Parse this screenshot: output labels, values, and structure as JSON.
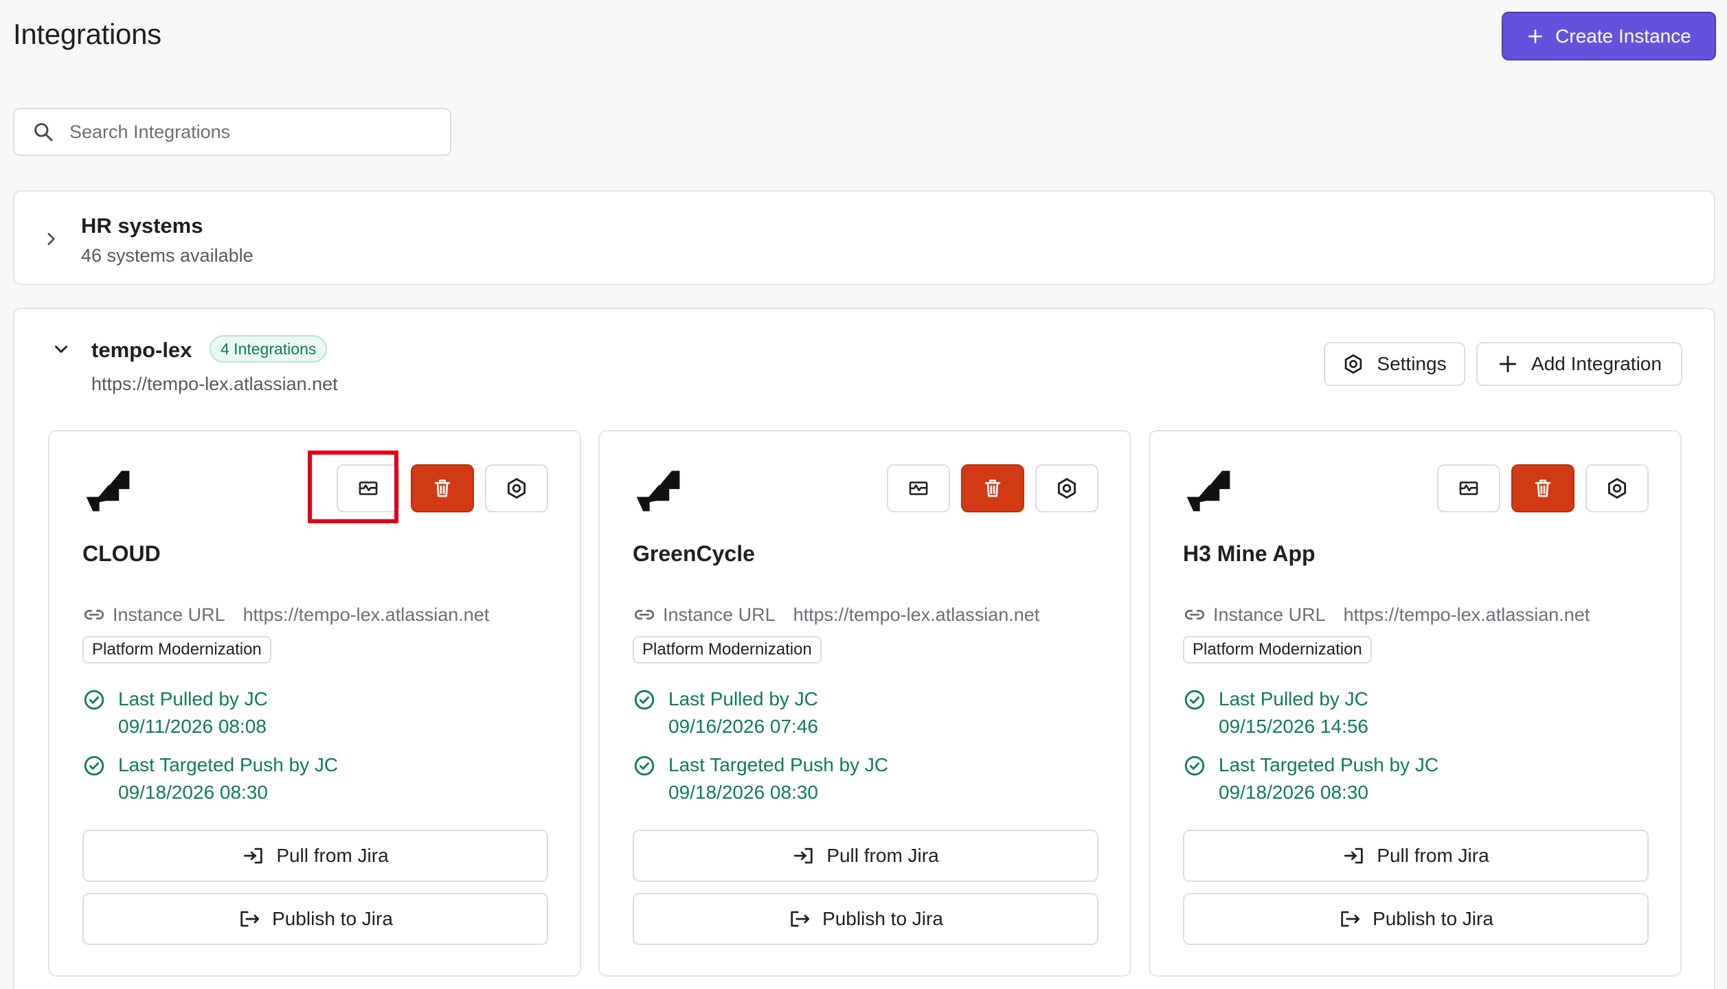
{
  "page": {
    "title": "Integrations"
  },
  "header": {
    "create_label": "Create Instance"
  },
  "search": {
    "placeholder": "Search Integrations",
    "value": ""
  },
  "groups": [
    {
      "name": "HR systems",
      "subtitle": "46 systems available",
      "expanded": false
    },
    {
      "name": "tempo-lex",
      "badge": "4 Integrations",
      "subtitle": "https://tempo-lex.atlassian.net",
      "expanded": true,
      "settings_label": "Settings",
      "add_label": "Add Integration",
      "cards": [
        {
          "title": "CLOUD",
          "url_label": "Instance URL",
          "url": "https://tempo-lex.atlassian.net",
          "tag": "Platform Modernization",
          "pulled_label": "Last Pulled by JC",
          "pulled_time": "09/11/2026 08:08",
          "pushed_label": "Last Targeted Push by JC",
          "pushed_time": "09/18/2026 08:30",
          "pull_label": "Pull from Jira",
          "publish_label": "Publish to Jira"
        },
        {
          "title": "GreenCycle",
          "url_label": "Instance URL",
          "url": "https://tempo-lex.atlassian.net",
          "tag": "Platform Modernization",
          "pulled_label": "Last Pulled by JC",
          "pulled_time": "09/16/2026 07:46",
          "pushed_label": "Last Targeted Push by JC",
          "pushed_time": "09/18/2026 08:30",
          "pull_label": "Pull from Jira",
          "publish_label": "Publish to Jira"
        },
        {
          "title": "H3 Mine App",
          "url_label": "Instance URL",
          "url": "https://tempo-lex.atlassian.net",
          "tag": "Platform Modernization",
          "pulled_label": "Last Pulled by JC",
          "pulled_time": "09/15/2026 14:56",
          "pushed_label": "Last Targeted Push by JC",
          "pushed_time": "09/18/2026 08:30",
          "pull_label": "Pull from Jira",
          "publish_label": "Publish to Jira"
        }
      ]
    }
  ],
  "colors": {
    "accent": "#6552dc",
    "danger": "#d23a14",
    "success": "#0f7a5c",
    "highlight": "#e0001b"
  }
}
